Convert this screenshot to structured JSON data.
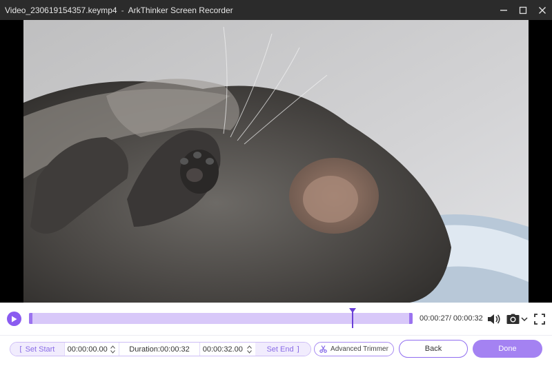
{
  "window": {
    "file_name": "Video_230619154357.keymp4",
    "separator": "-",
    "app_name": "ArkThinker Screen Recorder",
    "buttons": [
      "minimize-icon",
      "maximize-icon",
      "close-icon"
    ]
  },
  "player": {
    "time_readout": "00:00:27/ 00:00:32",
    "progress": 0.844,
    "icons": [
      "play-icon",
      "volume-icon",
      "camera-icon",
      "chevron-down-icon",
      "fullscreen-icon"
    ],
    "accent": "#8a5bf0"
  },
  "trim": {
    "set_start_label": "Set Start",
    "start_value": "00:00:00.00",
    "duration_text": "Duration:00:00:32",
    "end_value": "00:00:32.00",
    "set_end_label": "Set End",
    "advanced_label": "Advanced Trimmer"
  },
  "actions": {
    "back_label": "Back",
    "done_label": "Done"
  }
}
